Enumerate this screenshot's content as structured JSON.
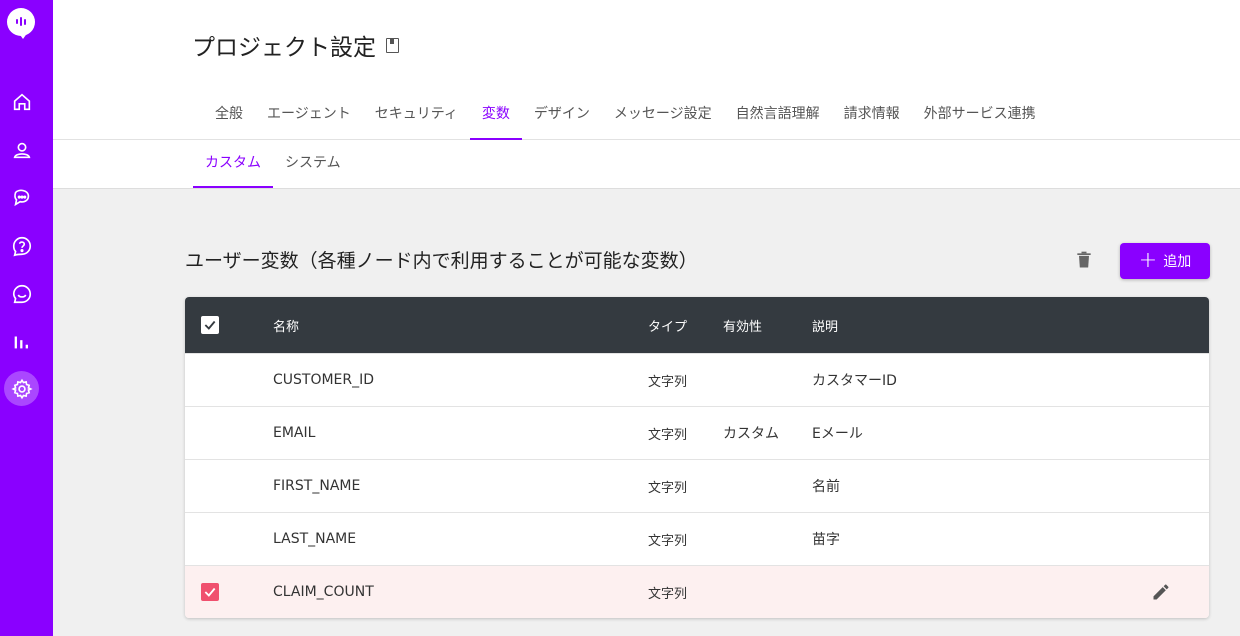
{
  "sidebar": {
    "items": [
      {
        "icon": "home-icon"
      },
      {
        "icon": "user-icon"
      },
      {
        "icon": "chat-icon"
      },
      {
        "icon": "help-icon"
      },
      {
        "icon": "message-icon"
      },
      {
        "icon": "analytics-icon"
      },
      {
        "icon": "settings-icon",
        "active": true
      }
    ],
    "accent": "#8a00ff"
  },
  "header": {
    "title": "プロジェクト設定",
    "tabs": [
      {
        "label": "全般"
      },
      {
        "label": "エージェント"
      },
      {
        "label": "セキュリティ"
      },
      {
        "label": "変数",
        "active": true
      },
      {
        "label": "デザイン"
      },
      {
        "label": "メッセージ設定"
      },
      {
        "label": "自然言語理解"
      },
      {
        "label": "請求情報"
      },
      {
        "label": "外部サービス連携"
      }
    ]
  },
  "subtabs": [
    {
      "label": "カスタム",
      "active": true
    },
    {
      "label": "システム"
    }
  ],
  "section": {
    "title": "ユーザー変数（各種ノード内で利用することが可能な変数）",
    "add_label": "追加"
  },
  "table": {
    "columns": {
      "name": "名称",
      "type": "タイプ",
      "validity": "有効性",
      "description": "説明"
    },
    "rows": [
      {
        "name": "CUSTOMER_ID",
        "type": "文字列",
        "validity": "",
        "description": "カスタマーID",
        "checked": false
      },
      {
        "name": "EMAIL",
        "type": "文字列",
        "validity": "カスタム",
        "description": "Eメール",
        "checked": false
      },
      {
        "name": "FIRST_NAME",
        "type": "文字列",
        "validity": "",
        "description": "名前",
        "checked": false
      },
      {
        "name": "LAST_NAME",
        "type": "文字列",
        "validity": "",
        "description": "苗字",
        "checked": false
      },
      {
        "name": "CLAIM_COUNT",
        "type": "文字列",
        "validity": "",
        "description": "",
        "checked": true
      }
    ]
  }
}
